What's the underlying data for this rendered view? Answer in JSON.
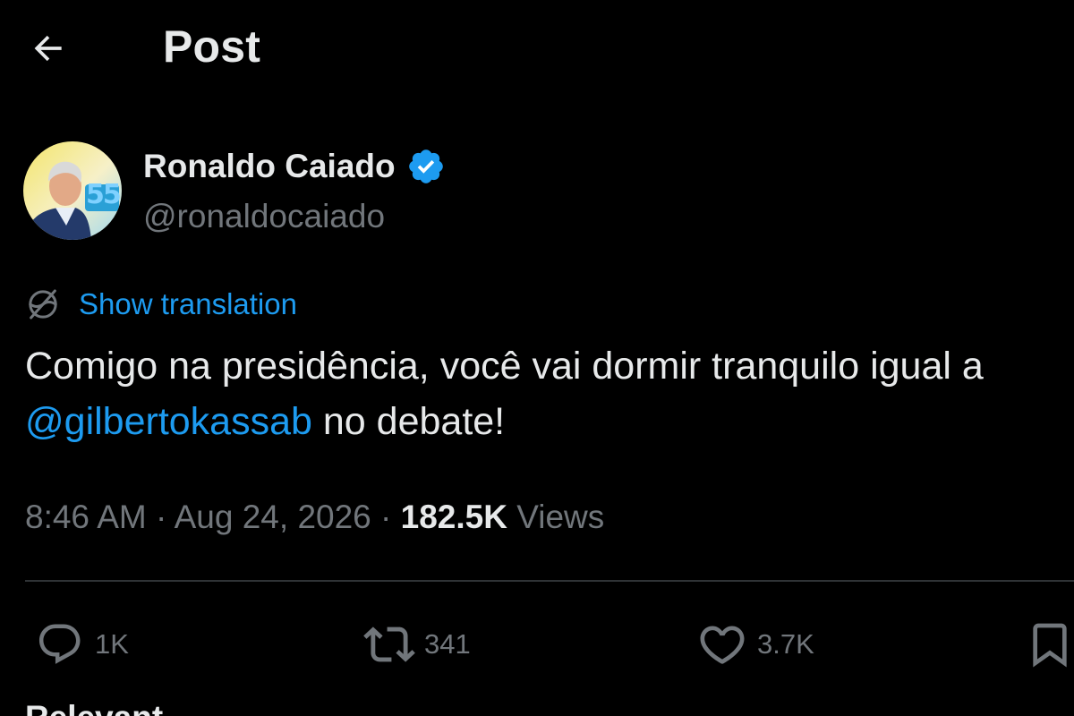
{
  "header": {
    "back_icon": "arrow-left-icon",
    "title": "Post"
  },
  "author": {
    "name": "Ronaldo Caiado",
    "handle": "@ronaldocaiado",
    "verified_icon": "verified-badge-icon",
    "verified_color": "#1d9bf0",
    "avatar_badge_text": "55"
  },
  "translation": {
    "icon": "globe-slash-icon",
    "label": "Show translation"
  },
  "post": {
    "line1": "Comigo na presidência, você vai dormir tranquilo igual a",
    "mention": "@gilbertokassab",
    "line2_rest": " no debate!"
  },
  "meta": {
    "time": "8:46 AM",
    "separator": " · ",
    "date": "Aug 24, 2026",
    "views_count": "182.5K",
    "views_label": " Views"
  },
  "actions": {
    "reply": {
      "icon": "reply-icon",
      "count": "1K"
    },
    "repost": {
      "icon": "repost-icon",
      "count": "341"
    },
    "like": {
      "icon": "heart-icon",
      "count": "3.7K"
    },
    "bookmark": {
      "icon": "bookmark-icon"
    }
  },
  "section": {
    "relevant_label": "Relevant"
  },
  "colors": {
    "background": "#000000",
    "text_primary": "#e7e9ea",
    "text_secondary": "#71767b",
    "link": "#1d9bf0",
    "divider": "#2f3336"
  }
}
